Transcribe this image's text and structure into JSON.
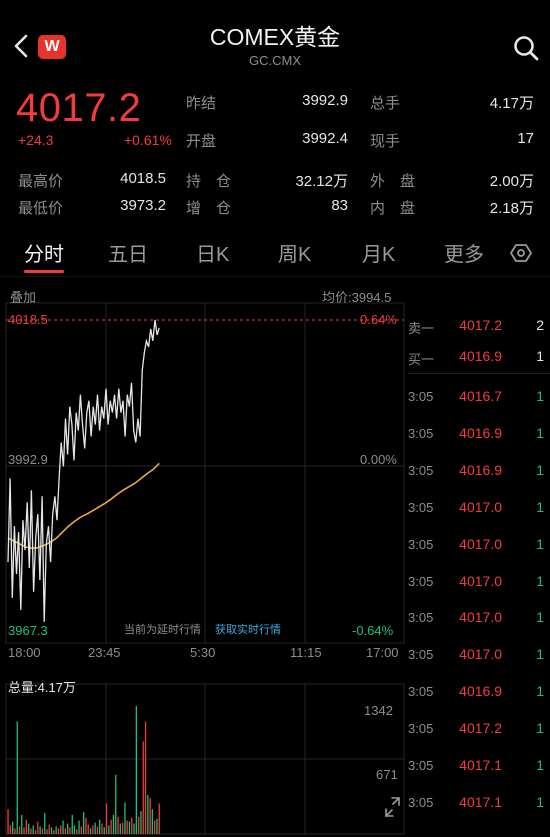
{
  "header": {
    "logo_text": "W",
    "title": "COMEX黄金",
    "subtitle": "GC.CMX"
  },
  "quote": {
    "price": "4017.2",
    "change": "+24.3",
    "change_pct": "+0.61%",
    "stats": [
      {
        "label": "昨结",
        "value": "3992.9"
      },
      {
        "label": "总手",
        "value": "4.17万"
      },
      {
        "label": "开盘",
        "value": "3992.4"
      },
      {
        "label": "现手",
        "value": "17"
      },
      {
        "label": "最高价",
        "value": "4018.5"
      },
      {
        "label": "持　仓",
        "value": "32.12万"
      },
      {
        "label": "外　盘",
        "value": "2.00万"
      },
      {
        "label": "最低价",
        "value": "3973.2"
      },
      {
        "label": "增　仓",
        "value": "83"
      },
      {
        "label": "内　盘",
        "value": "2.18万"
      }
    ]
  },
  "tabs": [
    {
      "label": "分时",
      "active": true
    },
    {
      "label": "五日"
    },
    {
      "label": "日K"
    },
    {
      "label": "周K"
    },
    {
      "label": "月K"
    },
    {
      "label": "更多"
    }
  ],
  "chart": {
    "overlay_label": "叠加",
    "avg_label": "均价:3994.5",
    "high_label": "4018.5",
    "high_pct": "0.64%",
    "mid_label": "3992.9",
    "mid_pct": "0.00%",
    "low_label": "3967.3",
    "low_pct": "-0.64%",
    "delay_notice": "当前为延时行情",
    "realtime_link": "获取实时行情",
    "time_ticks": [
      "18:00",
      "23:45",
      "5:30",
      "11:15",
      "17:00"
    ],
    "volume_label": "总量:4.17万",
    "vol_max_label": "1342",
    "vol_mid_label": "671"
  },
  "chart_data": {
    "type": "line",
    "ylim": [
      3967.3,
      4018.5
    ],
    "price_series": [
      3978,
      3992,
      3972,
      3984,
      3976,
      3983,
      3970,
      3985,
      3980,
      3988,
      3977,
      3990,
      3973,
      3982,
      3986,
      3975,
      3989,
      3968,
      3981,
      3984,
      3978,
      3986,
      3989,
      3985,
      3992,
      3998,
      3994,
      4002,
      3996,
      4004,
      4001,
      3995,
      4003,
      4000,
      4006,
      4001,
      3997,
      4003,
      4005,
      3999,
      4004,
      4001,
      4006,
      4000,
      4004,
      4002,
      4007,
      4001,
      4005,
      4003,
      4006,
      4002,
      4007,
      4003,
      4005,
      3999,
      4006,
      4004,
      4008,
      4000,
      3998,
      4002,
      3999,
      4010,
      4013,
      4015,
      4014,
      4017,
      4015,
      4018.5,
      4016,
      4017.2
    ],
    "avg_series": [
      3982,
      3981.5,
      3981,
      3980.5,
      3980.3,
      3980.4,
      3980.8,
      3981.3,
      3982,
      3983,
      3984,
      3984.8,
      3985.5,
      3986,
      3986.6,
      3987.2,
      3987.8,
      3988.5,
      3989.3,
      3990,
      3990.6,
      3991.2,
      3992,
      3992.8,
      3993.5,
      3994.5
    ],
    "volume_series": [
      260,
      90,
      130,
      60,
      1180,
      80,
      200,
      70,
      150,
      110,
      60,
      90,
      40,
      130,
      80,
      60,
      220,
      50,
      100,
      70,
      40,
      80,
      60,
      90,
      140,
      60,
      110,
      70,
      200,
      90,
      50,
      140,
      80,
      230,
      170,
      100,
      60,
      90,
      120,
      80,
      150,
      110,
      70,
      320,
      90,
      150,
      200,
      620,
      180,
      110,
      120,
      330,
      140,
      130,
      170,
      110,
      1342,
      180,
      240,
      970,
      1180,
      410,
      380,
      260,
      140,
      160,
      320
    ],
    "vol_ylim": [
      0,
      1342
    ]
  },
  "order_book": {
    "sell": {
      "label": "卖一",
      "price": "4017.2",
      "qty": "2"
    },
    "buy": {
      "label": "买一",
      "price": "4016.9",
      "qty": "1"
    },
    "trades": [
      {
        "time": "3:05",
        "price": "4016.7",
        "qty": "1"
      },
      {
        "time": "3:05",
        "price": "4016.9",
        "qty": "1"
      },
      {
        "time": "3:05",
        "price": "4016.9",
        "qty": "1"
      },
      {
        "time": "3:05",
        "price": "4017.0",
        "qty": "1"
      },
      {
        "time": "3:05",
        "price": "4017.0",
        "qty": "1"
      },
      {
        "time": "3:05",
        "price": "4017.0",
        "qty": "1"
      },
      {
        "time": "3:05",
        "price": "4017.0",
        "qty": "1"
      },
      {
        "time": "3:05",
        "price": "4017.0",
        "qty": "1"
      },
      {
        "time": "3:05",
        "price": "4016.9",
        "qty": "1"
      },
      {
        "time": "3:05",
        "price": "4017.2",
        "qty": "1"
      },
      {
        "time": "3:05",
        "price": "4017.1",
        "qty": "1"
      },
      {
        "time": "3:05",
        "price": "4017.1",
        "qty": "1"
      }
    ]
  },
  "colors": {
    "up": "#f23c3c",
    "down": "#19c27a",
    "avg_line": "#e8a94a",
    "price_line": "#e6e6e6"
  }
}
